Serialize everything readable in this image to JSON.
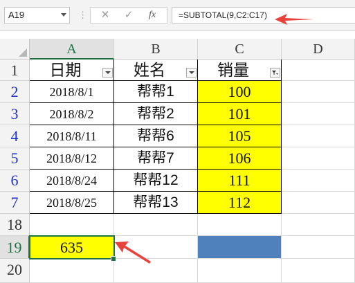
{
  "name_box": "A19",
  "formula": "=SUBTOTAL(9,C2:C17)",
  "toolbar": {
    "cancel_icon": "✕",
    "enter_icon": "✓",
    "function_label": "fx",
    "sep": "⋮"
  },
  "columns": [
    "A",
    "B",
    "C",
    "D"
  ],
  "row_numbers": [
    "1",
    "2",
    "3",
    "4",
    "5",
    "6",
    "7",
    "18",
    "19",
    "20"
  ],
  "headers": {
    "date": "日期",
    "name": "姓名",
    "sales": "销量"
  },
  "rows": [
    {
      "date": "2018/8/1",
      "name": "帮帮1",
      "sales": "100"
    },
    {
      "date": "2018/8/2",
      "name": "帮帮2",
      "sales": "101"
    },
    {
      "date": "2018/8/11",
      "name": "帮帮6",
      "sales": "105"
    },
    {
      "date": "2018/8/12",
      "name": "帮帮7",
      "sales": "106"
    },
    {
      "date": "2018/8/24",
      "name": "帮帮12",
      "sales": "111"
    },
    {
      "date": "2018/8/25",
      "name": "帮帮13",
      "sales": "112"
    }
  ],
  "total": "635",
  "colors": {
    "highlight": "#ffff00",
    "blue_fill": "#4f81bd",
    "arrow": "#e8433a",
    "selection": "#217346",
    "filtered_row_number": "#1f32c8"
  },
  "icons": {
    "filter_dropdown": "dropdown-arrow-icon",
    "filter_active": "funnel-icon",
    "annotation": "red-arrow-icon"
  }
}
